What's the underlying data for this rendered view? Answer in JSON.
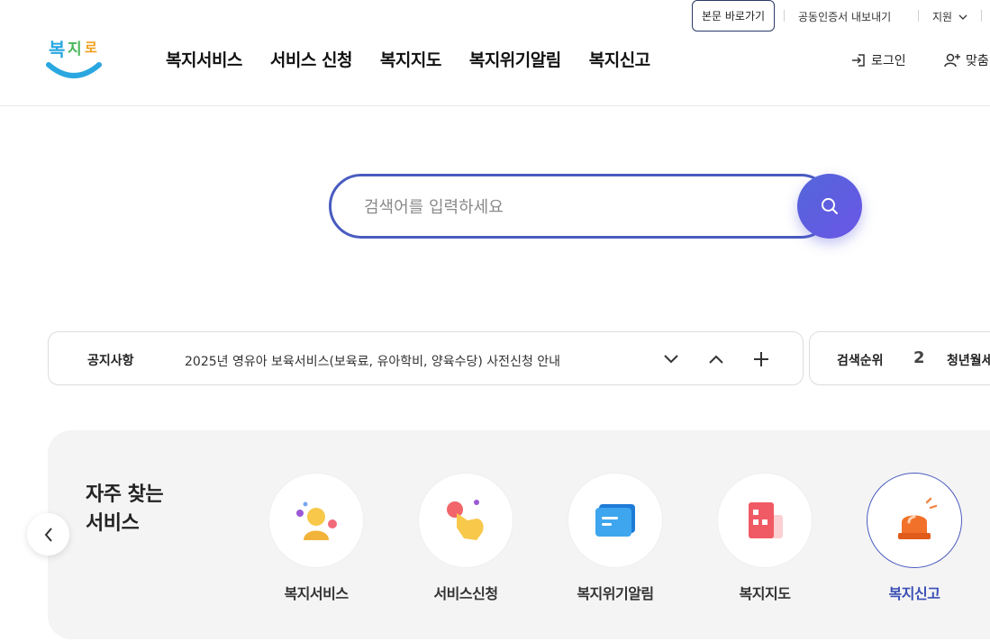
{
  "utility": {
    "skip_link": "본문 바로가기",
    "cert_export": "공동인증서 내보내기",
    "support": "지원"
  },
  "header": {
    "logo_text": "복지로",
    "nav": [
      "복지서비스",
      "서비스 신청",
      "복지지도",
      "복지위기알림",
      "복지신고"
    ],
    "login": "로그인",
    "custom": "맞춤"
  },
  "search": {
    "placeholder": "검색어를 입력하세요"
  },
  "notice": {
    "label": "공지사항",
    "text": "2025년 영유아 보육서비스(보육료, 유아학비, 양육수당) 사전신청 안내"
  },
  "ranking": {
    "label": "검색순위",
    "number": "2",
    "text": "청년월세"
  },
  "favorites": {
    "title_line1": "자주 찾는",
    "title_line2": "서비스",
    "items": [
      {
        "label": "복지서비스",
        "icon": "person-icon"
      },
      {
        "label": "서비스신청",
        "icon": "hand-tap-icon"
      },
      {
        "label": "복지위기알림",
        "icon": "message-card-icon"
      },
      {
        "label": "복지지도",
        "icon": "building-icon"
      },
      {
        "label": "복지신고",
        "icon": "siren-icon"
      }
    ]
  },
  "colors": {
    "accent": "#4a5bc0",
    "active_label": "#3a4fb5",
    "panel_bg": "#f4f4f4"
  }
}
